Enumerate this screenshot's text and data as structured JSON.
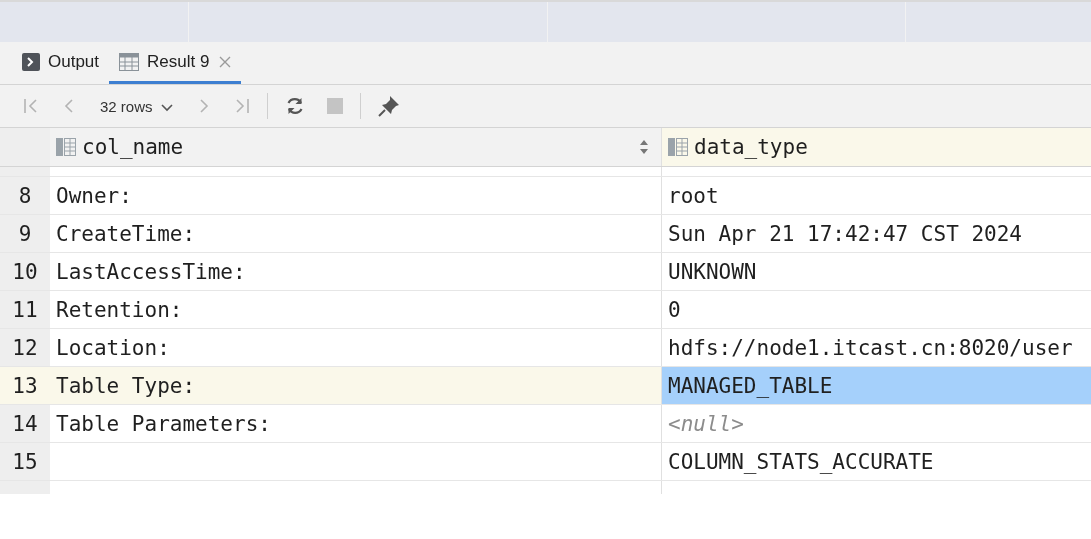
{
  "tabs": [
    {
      "label": "Output",
      "kind": "console",
      "selected": false,
      "closable": false
    },
    {
      "label": "Result 9",
      "kind": "table",
      "selected": true,
      "closable": true
    }
  ],
  "toolbar": {
    "page_size": "32 rows"
  },
  "table": {
    "columns": [
      {
        "name": "col_name",
        "sortable": true
      },
      {
        "name": "data_type",
        "sortable": false
      }
    ],
    "rows": [
      {
        "number": "8",
        "selected": false,
        "cells": [
          {
            "text": "Owner:",
            "kind": "text",
            "selected": false
          },
          {
            "text": "root",
            "kind": "text",
            "selected": false
          }
        ]
      },
      {
        "number": "9",
        "selected": false,
        "cells": [
          {
            "text": "CreateTime:",
            "kind": "text",
            "selected": false
          },
          {
            "text": "Sun Apr 21 17:42:47 CST 2024",
            "kind": "text",
            "selected": false
          }
        ]
      },
      {
        "number": "10",
        "selected": false,
        "cells": [
          {
            "text": "LastAccessTime:",
            "kind": "text",
            "selected": false
          },
          {
            "text": "UNKNOWN",
            "kind": "text",
            "selected": false
          }
        ]
      },
      {
        "number": "11",
        "selected": false,
        "cells": [
          {
            "text": "Retention:",
            "kind": "text",
            "selected": false
          },
          {
            "text": "0",
            "kind": "text",
            "selected": false
          }
        ]
      },
      {
        "number": "12",
        "selected": false,
        "cells": [
          {
            "text": "Location:",
            "kind": "text",
            "selected": false
          },
          {
            "text": "hdfs://node1.itcast.cn:8020/user",
            "kind": "text",
            "selected": false
          }
        ]
      },
      {
        "number": "13",
        "selected": true,
        "cells": [
          {
            "text": "Table Type:",
            "kind": "text",
            "selected": false
          },
          {
            "text": "MANAGED_TABLE",
            "kind": "text",
            "selected": true
          }
        ]
      },
      {
        "number": "14",
        "selected": false,
        "cells": [
          {
            "text": "Table Parameters:",
            "kind": "text",
            "selected": false
          },
          {
            "text": "<null>",
            "kind": "null",
            "selected": false
          }
        ]
      },
      {
        "number": "15",
        "selected": false,
        "cells": [
          {
            "kind": "empty",
            "selected": false
          },
          {
            "text": "COLUMN_STATS_ACCURATE",
            "kind": "text",
            "selected": false
          }
        ]
      }
    ]
  }
}
